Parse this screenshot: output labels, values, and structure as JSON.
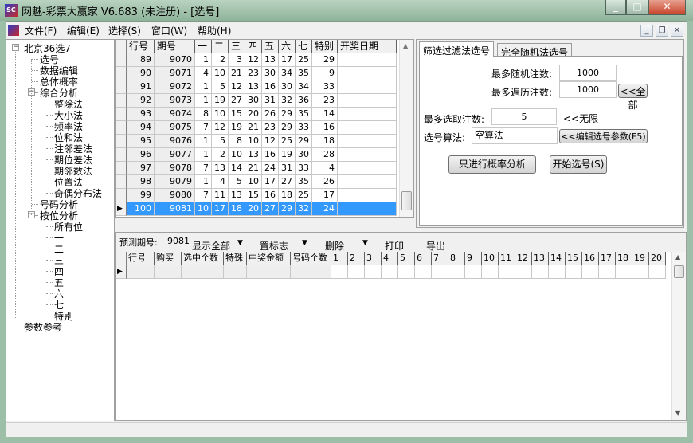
{
  "window": {
    "title": "网魅-彩票大赢家 V6.683 (未注册) - [选号]",
    "icon": "SC"
  },
  "menu": [
    "文件(F)",
    "编辑(E)",
    "选择(S)",
    "窗口(W)",
    "帮助(H)"
  ],
  "tree": {
    "root": "北京36选7",
    "items": [
      {
        "label": "选号",
        "level": 1
      },
      {
        "label": "数据编辑",
        "level": 1
      },
      {
        "label": "总体概率",
        "level": 1
      },
      {
        "label": "综合分析",
        "level": 1,
        "expanded": true
      },
      {
        "label": "整除法",
        "level": 2
      },
      {
        "label": "大小法",
        "level": 2
      },
      {
        "label": "频率法",
        "level": 2
      },
      {
        "label": "位和法",
        "level": 2
      },
      {
        "label": "注邻差法",
        "level": 2
      },
      {
        "label": "期位差法",
        "level": 2
      },
      {
        "label": "期邻数法",
        "level": 2
      },
      {
        "label": "位置法",
        "level": 2
      },
      {
        "label": "奇偶分布法",
        "level": 2
      },
      {
        "label": "号码分析",
        "level": 1
      },
      {
        "label": "按位分析",
        "level": 1,
        "expanded": true
      },
      {
        "label": "所有位",
        "level": 2
      },
      {
        "label": "一",
        "level": 2
      },
      {
        "label": "二",
        "level": 2
      },
      {
        "label": "三",
        "level": 2
      },
      {
        "label": "四",
        "level": 2
      },
      {
        "label": "五",
        "level": 2
      },
      {
        "label": "六",
        "level": 2
      },
      {
        "label": "七",
        "level": 2
      },
      {
        "label": "特别",
        "level": 2
      },
      {
        "label": "参数参考",
        "level": 0
      }
    ]
  },
  "draws": {
    "columns": [
      "行号",
      "期号",
      "一",
      "二",
      "三",
      "四",
      "五",
      "六",
      "七",
      "特别",
      "开奖日期"
    ],
    "rows": [
      [
        89,
        9070,
        1,
        2,
        3,
        12,
        13,
        17,
        25,
        29
      ],
      [
        90,
        9071,
        4,
        10,
        21,
        23,
        30,
        34,
        35,
        9
      ],
      [
        91,
        9072,
        1,
        5,
        12,
        13,
        16,
        30,
        34,
        33
      ],
      [
        92,
        9073,
        1,
        19,
        27,
        30,
        31,
        32,
        36,
        23
      ],
      [
        93,
        9074,
        8,
        10,
        15,
        20,
        26,
        29,
        35,
        14
      ],
      [
        94,
        9075,
        7,
        12,
        19,
        21,
        23,
        29,
        33,
        16
      ],
      [
        95,
        9076,
        1,
        5,
        8,
        10,
        12,
        25,
        29,
        18
      ],
      [
        96,
        9077,
        1,
        2,
        10,
        13,
        16,
        19,
        30,
        28
      ],
      [
        97,
        9078,
        7,
        13,
        14,
        21,
        24,
        31,
        33,
        4
      ],
      [
        98,
        9079,
        1,
        4,
        5,
        10,
        17,
        27,
        35,
        26
      ],
      [
        99,
        9080,
        7,
        11,
        13,
        15,
        16,
        18,
        25,
        17
      ],
      [
        100,
        9081,
        10,
        17,
        18,
        20,
        27,
        29,
        32,
        24
      ]
    ],
    "selected_row": 100
  },
  "tabs": [
    "筛选过滤法选号",
    "完全随机法选号"
  ],
  "filter": {
    "max_random_label": "最多随机注数:",
    "max_random": "1000",
    "max_traverse_label": "最多遍历注数:",
    "max_traverse": "1000",
    "all_btn": "<<全部",
    "max_pick_label": "最多选取注数:",
    "max_pick": "5",
    "unlimited": "<<无限",
    "algo_label": "选号算法:",
    "algo": "空算法",
    "edit_btn": "<<编辑选号参数(F5)",
    "prob_btn": "只进行概率分析",
    "start_btn": "开始选号(S)"
  },
  "toolbar": {
    "predict_label": "预测期号:",
    "predict_value": "9081",
    "show_all": "显示全部",
    "mark": "置标志",
    "delete": "删除",
    "print": "打印",
    "export": "导出"
  },
  "results": {
    "columns": [
      "行号",
      "购买",
      "选中个数",
      "特殊",
      "中奖金额",
      "号码个数",
      "1",
      "2",
      "3",
      "4",
      "5",
      "6",
      "7",
      "8",
      "9",
      "10",
      "11",
      "12",
      "13",
      "14",
      "15",
      "16",
      "17",
      "18",
      "19",
      "20"
    ]
  }
}
